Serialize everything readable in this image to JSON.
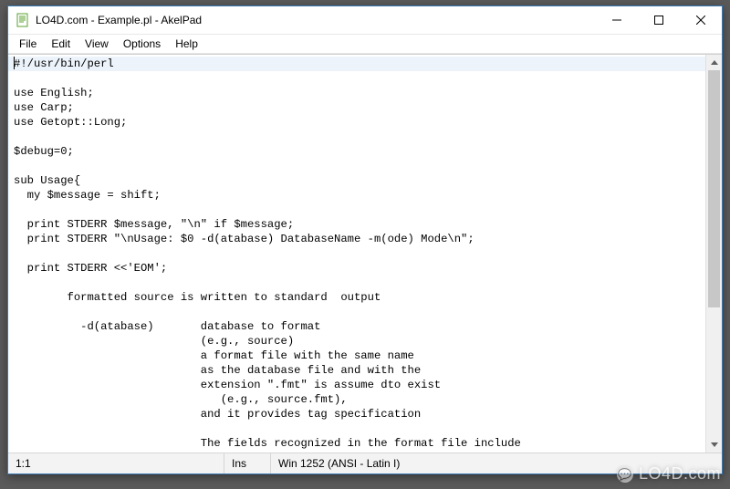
{
  "window": {
    "title": "LO4D.com - Example.pl - AkelPad"
  },
  "menubar": {
    "items": [
      "File",
      "Edit",
      "View",
      "Options",
      "Help"
    ]
  },
  "editor": {
    "content": "#!/usr/bin/perl\n\nuse English;\nuse Carp;\nuse Getopt::Long;\n\n$debug=0;\n\nsub Usage{\n  my $message = shift;\n\n  print STDERR $message, \"\\n\" if $message;\n  print STDERR \"\\nUsage: $0 -d(atabase) DatabaseName -m(ode) Mode\\n\";\n\n  print STDERR <<'EOM';\n\n        formatted source is written to standard  output\n\n          -d(atabase)       database to format\n                            (e.g., source)\n                            a format file with the same name\n                            as the database file and with the\n                            extension \".fmt\" is assume dto exist\n                               (e.g., source.fmt),\n                            and it provides tag specification\n\n                            The fields recognized in the format file include\n                               TITLE  IGNORE  DOCBEGIN"
  },
  "statusbar": {
    "position": "1:1",
    "insert_mode": "Ins",
    "encoding": "Win  1252  (ANSI - Latin I)"
  },
  "watermark": {
    "text": "LO4D.com"
  }
}
